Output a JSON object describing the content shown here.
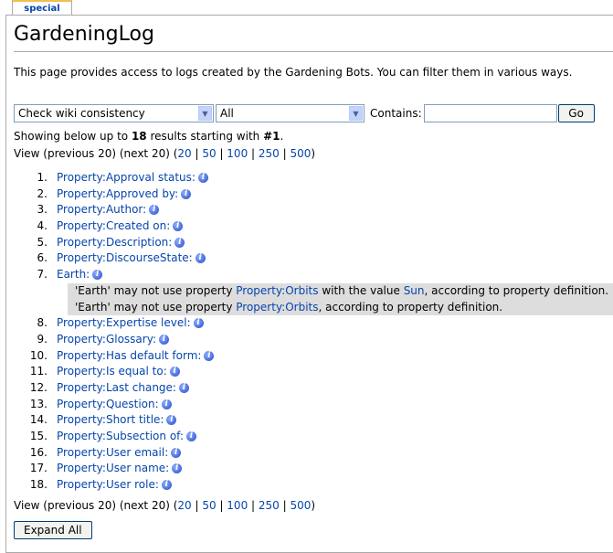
{
  "tab": {
    "label": "special"
  },
  "page": {
    "title": "GardeningLog",
    "intro": "This page provides access to logs created by the Gardening Bots. You can filter them in various ways."
  },
  "filters": {
    "bot_select": "Check wiki consistency",
    "type_select": "All",
    "contains_label": "Contains:",
    "contains_value": "",
    "go_label": "Go"
  },
  "results": {
    "showing_prefix": "Showing below up to ",
    "count": "18",
    "showing_middle": " results starting with ",
    "start": "#1",
    "showing_suffix": "."
  },
  "pager": {
    "prefix": "View (previous 20) (next 20) (",
    "limits": [
      "20",
      "50",
      "100",
      "250",
      "500"
    ],
    "sep": " | ",
    "suffix": ")"
  },
  "items": [
    {
      "n": "1.",
      "label": "Property:Approval status:"
    },
    {
      "n": "2.",
      "label": "Property:Approved by:"
    },
    {
      "n": "3.",
      "label": "Property:Author:"
    },
    {
      "n": "4.",
      "label": "Property:Created on:"
    },
    {
      "n": "5.",
      "label": "Property:Description:"
    },
    {
      "n": "6.",
      "label": "Property:DiscourseState:"
    },
    {
      "n": "7.",
      "label": "Earth:"
    },
    {
      "n": "8.",
      "label": "Property:Expertise level:"
    },
    {
      "n": "9.",
      "label": "Property:Glossary:"
    },
    {
      "n": "10.",
      "label": "Property:Has default form:"
    },
    {
      "n": "11.",
      "label": "Property:Is equal to:"
    },
    {
      "n": "12.",
      "label": "Property:Last change:"
    },
    {
      "n": "13.",
      "label": "Property:Question:"
    },
    {
      "n": "14.",
      "label": "Property:Short title:"
    },
    {
      "n": "15.",
      "label": "Property:Subsection of:"
    },
    {
      "n": "16.",
      "label": "Property:User email:"
    },
    {
      "n": "17.",
      "label": "Property:User name:"
    },
    {
      "n": "18.",
      "label": "Property:User role:"
    }
  ],
  "earth_details": [
    {
      "pre": "'Earth' may not use property ",
      "link": "Property:Orbits",
      "mid": " with the value ",
      "value": "Sun",
      "post": ", according to property definition."
    },
    {
      "pre": "'Earth' may not use property ",
      "link": "Property:Orbits",
      "post": ", according to property definition."
    }
  ],
  "icons": {
    "info": "i"
  },
  "expand_all": "Expand All"
}
